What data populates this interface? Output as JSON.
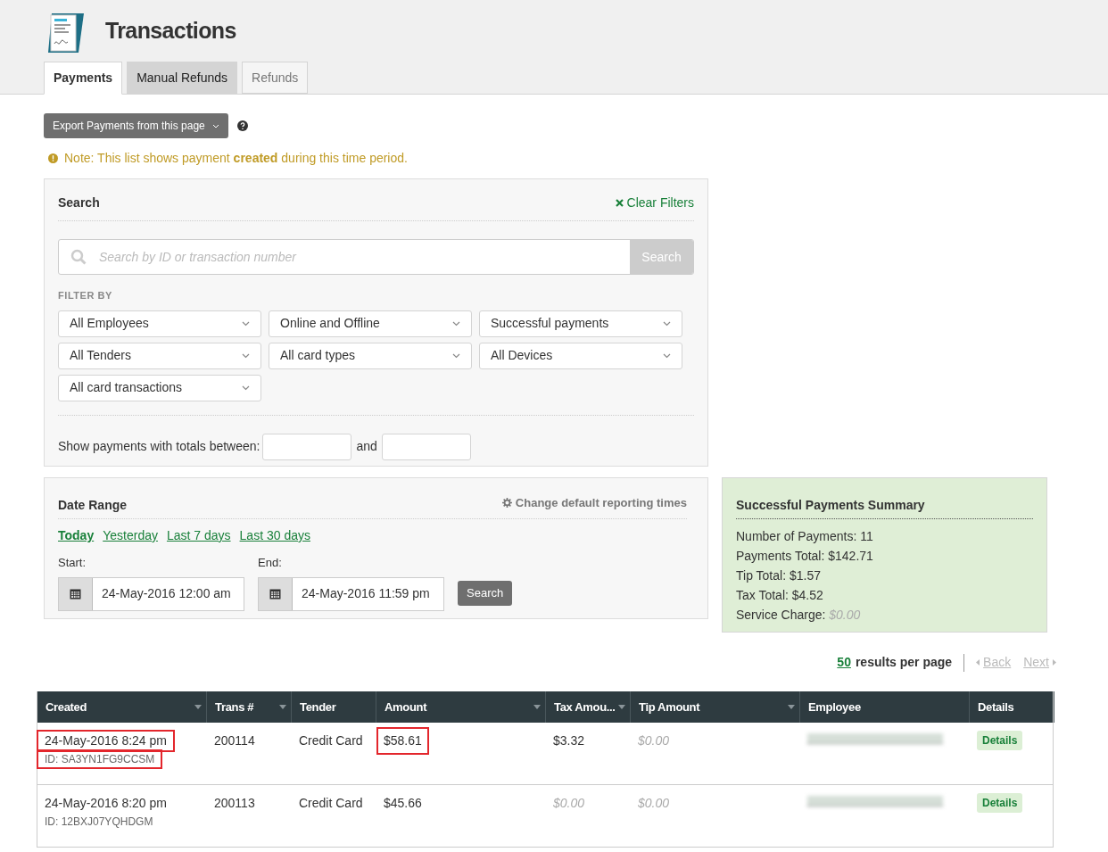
{
  "header": {
    "title": "Transactions"
  },
  "tabs": [
    {
      "label": "Payments",
      "selected": true
    },
    {
      "label": "Manual Refunds",
      "selected": false,
      "hovered": true
    },
    {
      "label": "Refunds",
      "selected": false,
      "hovered": false
    }
  ],
  "export_button": "Export Payments from this page",
  "note": "Note: This list shows payment **created** during this time period.",
  "search": {
    "title": "Search",
    "clear": "Clear Filters",
    "placeholder": "Search by ID or transaction number",
    "button": "Search",
    "filter_label": "FILTER BY",
    "filters": [
      "All Employees",
      "Online and Offline",
      "Successful payments",
      "All Tenders",
      "All card types",
      "All Devices",
      "All card transactions"
    ],
    "totals_label": "Show payments with totals between:",
    "and": "and"
  },
  "date_range": {
    "title": "Date Range",
    "change": "Change default reporting times",
    "presets": [
      {
        "label": "Today",
        "selected": true
      },
      {
        "label": "Yesterday",
        "selected": false
      },
      {
        "label": "Last 7 days",
        "selected": false
      },
      {
        "label": "Last 30 days",
        "selected": false
      }
    ],
    "start_label": "Start:",
    "start": "24-May-2016 12:00 am",
    "end_label": "End:",
    "end": "24-May-2016 11:59 pm",
    "button": "Search"
  },
  "summary": {
    "title": "Successful Payments Summary",
    "lines": [
      {
        "label": "Number of Payments:",
        "value": "11",
        "muted": false
      },
      {
        "label": "Payments Total:",
        "value": "$142.71",
        "muted": false
      },
      {
        "label": "Tip Total:",
        "value": "$1.57",
        "muted": false
      },
      {
        "label": "Tax Total:",
        "value": "$4.52",
        "muted": false
      },
      {
        "label": "Service Charge:",
        "value": "$0.00",
        "muted": true
      }
    ]
  },
  "pagination": {
    "per_page": "50",
    "per_page_label": "results per page",
    "back": "Back",
    "next": "Next",
    "back_disabled": true,
    "next_disabled": true
  },
  "table": {
    "columns": [
      {
        "label": "Created",
        "sortable": true
      },
      {
        "label": "Trans #",
        "sortable": true
      },
      {
        "label": "Tender",
        "sortable": false
      },
      {
        "label": "Amount",
        "sortable": true
      },
      {
        "label": "Tax Amou...",
        "sortable": true
      },
      {
        "label": "Tip Amount",
        "sortable": true
      },
      {
        "label": "Employee",
        "sortable": false
      },
      {
        "label": "Details",
        "sortable": false
      }
    ],
    "rows": [
      {
        "created": {
          "text": "24-May-2016 8:24 pm",
          "highlighted": true
        },
        "id": {
          "text": "ID: SA3YN1FG9CCSM",
          "highlighted": true
        },
        "trans": "200114",
        "tender": "Credit Card",
        "amount": {
          "text": "$58.61",
          "highlighted": true
        },
        "tax": {
          "text": "$3.32",
          "muted": false
        },
        "tip": {
          "text": "$0.00",
          "muted": true
        },
        "details": "Details"
      },
      {
        "created": {
          "text": "24-May-2016 8:20 pm",
          "highlighted": false
        },
        "id": {
          "text": "ID: 12BXJ07YQHDGM",
          "highlighted": false
        },
        "trans": "200113",
        "tender": "Credit Card",
        "amount": {
          "text": "$45.66",
          "highlighted": false
        },
        "tax": {
          "text": "$0.00",
          "muted": true
        },
        "tip": {
          "text": "$0.00",
          "muted": true
        },
        "details": "Details"
      }
    ]
  }
}
